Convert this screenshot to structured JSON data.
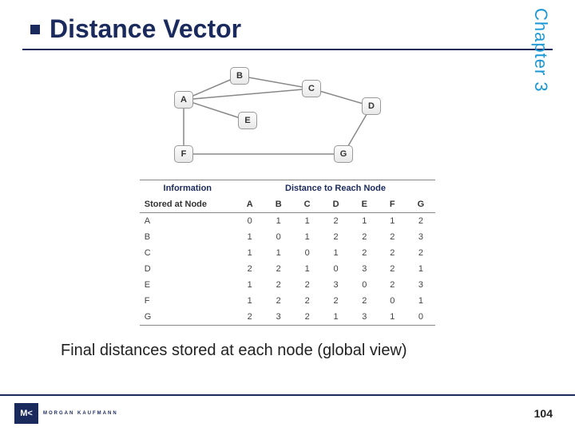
{
  "title": "Distance Vector",
  "chapter": "Chapter 3",
  "graph": {
    "nodes": [
      "A",
      "B",
      "C",
      "D",
      "E",
      "F",
      "G"
    ]
  },
  "table": {
    "header_info_line1": "Information",
    "header_info_line2": "Stored at Node",
    "header_span": "Distance to Reach Node",
    "cols": [
      "A",
      "B",
      "C",
      "D",
      "E",
      "F",
      "G"
    ],
    "rows": [
      {
        "label": "A",
        "vals": [
          "0",
          "1",
          "1",
          "2",
          "1",
          "1",
          "2"
        ]
      },
      {
        "label": "B",
        "vals": [
          "1",
          "0",
          "1",
          "2",
          "2",
          "2",
          "3"
        ]
      },
      {
        "label": "C",
        "vals": [
          "1",
          "1",
          "0",
          "1",
          "2",
          "2",
          "2"
        ]
      },
      {
        "label": "D",
        "vals": [
          "2",
          "2",
          "1",
          "0",
          "3",
          "2",
          "1"
        ]
      },
      {
        "label": "E",
        "vals": [
          "1",
          "2",
          "2",
          "3",
          "0",
          "2",
          "3"
        ]
      },
      {
        "label": "F",
        "vals": [
          "1",
          "2",
          "2",
          "2",
          "2",
          "0",
          "1"
        ]
      },
      {
        "label": "G",
        "vals": [
          "2",
          "3",
          "2",
          "1",
          "3",
          "1",
          "0"
        ]
      }
    ]
  },
  "caption": "Final distances stored at each node (global view)",
  "logo_mark": "M<",
  "logo_text": "MORGAN KAUFMANN",
  "page_number": "104"
}
